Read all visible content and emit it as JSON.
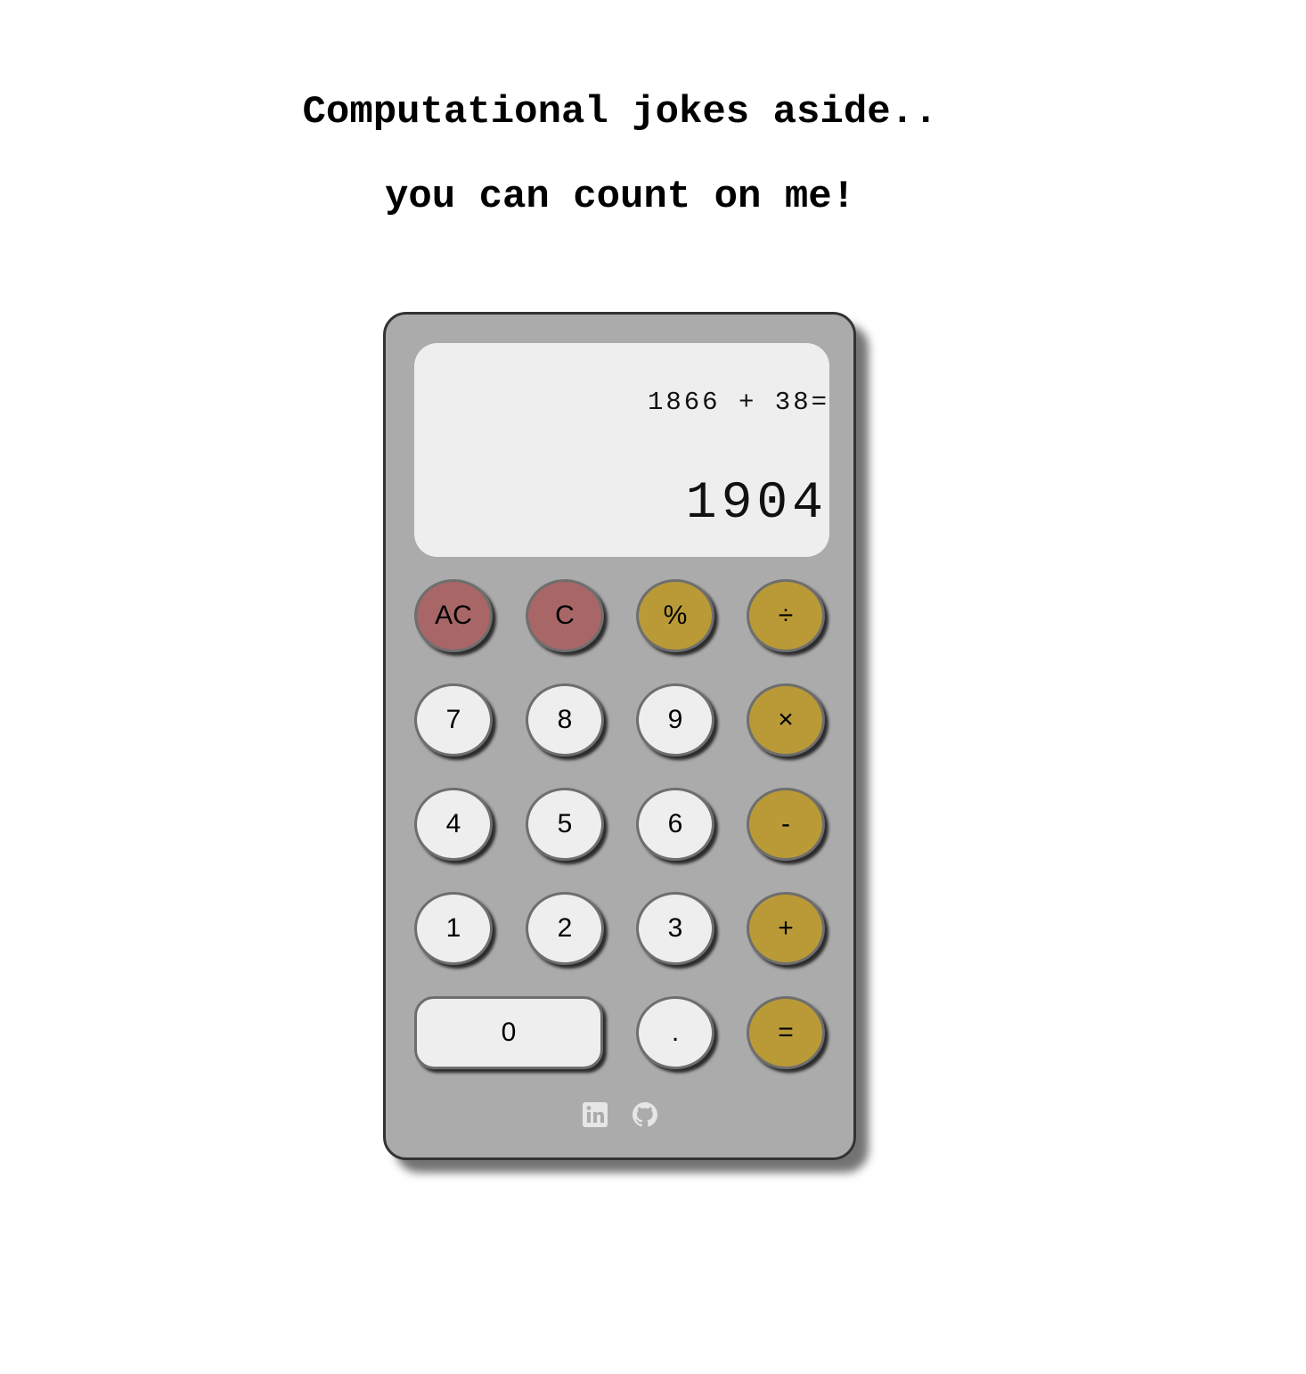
{
  "heading": {
    "line1": "Computational jokes aside..",
    "line2": "you can count on me!"
  },
  "display": {
    "expression": "1866 + 38=",
    "result": "1904"
  },
  "keys": {
    "all_clear": "AC",
    "clear": "C",
    "percent": "%",
    "divide": "÷",
    "seven": "7",
    "eight": "8",
    "nine": "9",
    "multiply": "×",
    "four": "4",
    "five": "5",
    "six": "6",
    "subtract": "-",
    "one": "1",
    "two": "2",
    "three": "3",
    "add": "+",
    "zero": "0",
    "decimal": ".",
    "equals": "="
  },
  "links": {
    "linkedin_icon": "linkedin-icon",
    "github_icon": "github-icon"
  },
  "colors": {
    "page_background": "#ffffff",
    "calculator_body": "#ababab",
    "display_background": "#eeeeee",
    "clear_keys": "#a86666",
    "operator_keys": "#b99a37",
    "number_keys": "#eeeeee",
    "link_icons": "#e6e6e6"
  }
}
